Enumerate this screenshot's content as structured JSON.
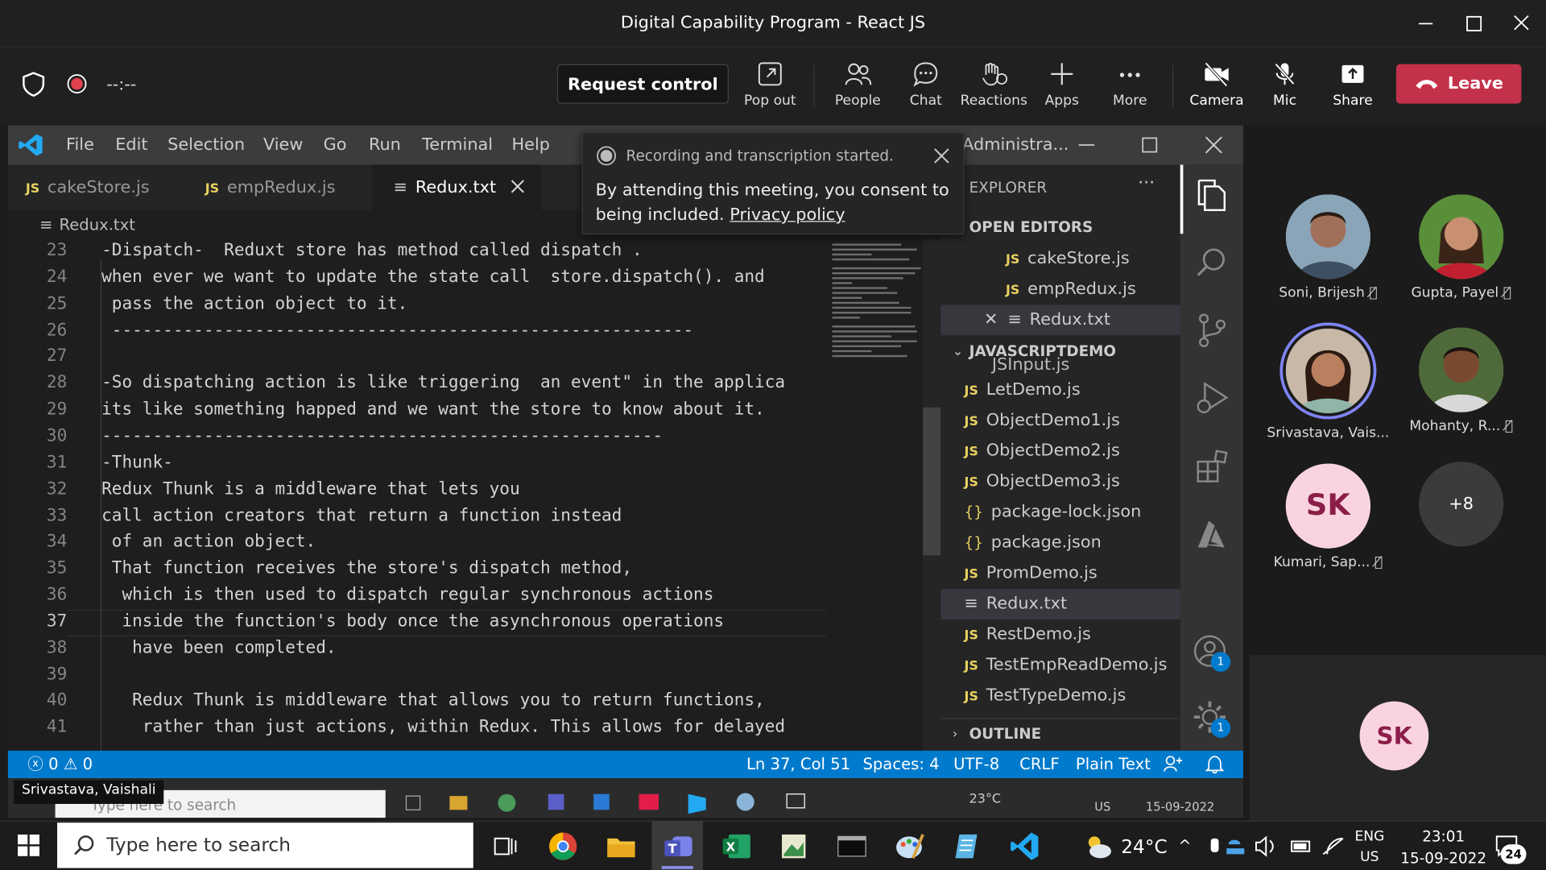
{
  "meeting": {
    "title": "Digital Capability Program - React JS",
    "timer": "--:--",
    "request_control": "Request control",
    "toolbar": [
      {
        "label": "Pop out",
        "icon": "popout-icon"
      },
      {
        "label": "People",
        "icon": "people-icon"
      },
      {
        "label": "Chat",
        "icon": "chat-icon"
      },
      {
        "label": "Reactions",
        "icon": "reactions-icon"
      },
      {
        "label": "Apps",
        "icon": "plus-icon"
      },
      {
        "label": "More",
        "icon": "more-icon"
      },
      {
        "label": "Camera",
        "icon": "camera-off-icon"
      },
      {
        "label": "Mic",
        "icon": "mic-off-icon"
      },
      {
        "label": "Share",
        "icon": "share-icon"
      }
    ],
    "leave": "Leave",
    "presenter_label": "Srivastava, Vaishali"
  },
  "toast": {
    "header": "Recording and transcription started.",
    "body": "By attending this meeting, you consent to being included.",
    "link": "Privacy policy"
  },
  "vscode": {
    "menu": [
      "File",
      "Edit",
      "Selection",
      "View",
      "Go",
      "Run",
      "Terminal",
      "Help"
    ],
    "title_fragment": "Administra...",
    "tabs": [
      "cakeStore.js",
      "empRedux.js",
      "Redux.txt"
    ],
    "breadcrumb": "Redux.txt",
    "lines": [
      {
        "n": "23",
        "t": "-Dispatch-  Reduxt store has method called dispatch ."
      },
      {
        "n": "24",
        "t": "when ever we want to update the state call  store.dispatch(). and"
      },
      {
        "n": "25",
        "t": " pass the action object to it."
      },
      {
        "n": "26",
        "t": " ---------------------------------------------------------"
      },
      {
        "n": "27",
        "t": ""
      },
      {
        "n": "28",
        "t": "-So dispatching action is like triggering  an event\" in the applica"
      },
      {
        "n": "29",
        "t": "its like something happed and we want the store to know about it."
      },
      {
        "n": "30",
        "t": "-------------------------------------------------------"
      },
      {
        "n": "31",
        "t": "-Thunk-"
      },
      {
        "n": "32",
        "t": "Redux Thunk is a middleware that lets you"
      },
      {
        "n": "33",
        "t": "call action creators that return a function instead"
      },
      {
        "n": "34",
        "t": " of an action object."
      },
      {
        "n": "35",
        "t": " That function receives the store's dispatch method,"
      },
      {
        "n": "36",
        "t": "  which is then used to dispatch regular synchronous actions"
      },
      {
        "n": "37",
        "t": "  inside the function's body once the asynchronous operations"
      },
      {
        "n": "38",
        "t": "   have been completed."
      },
      {
        "n": "39",
        "t": ""
      },
      {
        "n": "40",
        "t": "   Redux Thunk is middleware that allows you to return functions,"
      },
      {
        "n": "41",
        "t": "    rather than just actions, within Redux. This allows for delayed"
      }
    ],
    "explorer": {
      "title": "EXPLORER",
      "open_editors": "OPEN EDITORS",
      "open_files": [
        "cakeStore.js",
        "empRedux.js",
        "Redux.txt"
      ],
      "project": "JAVASCRIPTDEMO",
      "partial_file": "JSInput.js",
      "files": [
        {
          "name": "LetDemo.js",
          "type": "JS"
        },
        {
          "name": "ObjectDemo1.js",
          "type": "JS"
        },
        {
          "name": "ObjectDemo2.js",
          "type": "JS"
        },
        {
          "name": "ObjectDemo3.js",
          "type": "JS"
        },
        {
          "name": "package-lock.json",
          "type": "{}"
        },
        {
          "name": "package.json",
          "type": "{}"
        },
        {
          "name": "PromDemo.js",
          "type": "JS"
        },
        {
          "name": "Redux.txt",
          "type": "≡"
        },
        {
          "name": "RestDemo.js",
          "type": "JS"
        },
        {
          "name": "TestEmpReadDemo.js",
          "type": "JS"
        },
        {
          "name": "TestTypeDemo.js",
          "type": "JS"
        }
      ],
      "outline": "OUTLINE"
    },
    "activity_badges": [
      "1",
      "1"
    ],
    "status": {
      "errors": "0",
      "warnings": "0",
      "position": "Ln 37, Col 51",
      "spaces": "Spaces: 4",
      "encoding": "UTF-8",
      "eol": "CRLF",
      "language": "Plain Text"
    }
  },
  "participants": [
    {
      "name": "Soni, Brijesh",
      "muted": true
    },
    {
      "name": "Gupta, Payel",
      "muted": true
    },
    {
      "name": "Srivastava, Vais...",
      "muted": false
    },
    {
      "name": "Mohanty, R...",
      "muted": true
    },
    {
      "name": "Kumari, Sap...",
      "initials": "SK",
      "muted": true
    },
    {
      "name": "+8"
    }
  ],
  "self_view": {
    "initials": "SK"
  },
  "inner_taskbar": {
    "search": "Type here to search",
    "weather": "23°C",
    "lang": "US",
    "date": "15-09-2022"
  },
  "taskbar": {
    "search": "Type here to search",
    "weather": "24°C",
    "lang_top": "ENG",
    "lang_bottom": "US",
    "time": "23:01",
    "date": "15-09-2022",
    "notifications": "24"
  }
}
